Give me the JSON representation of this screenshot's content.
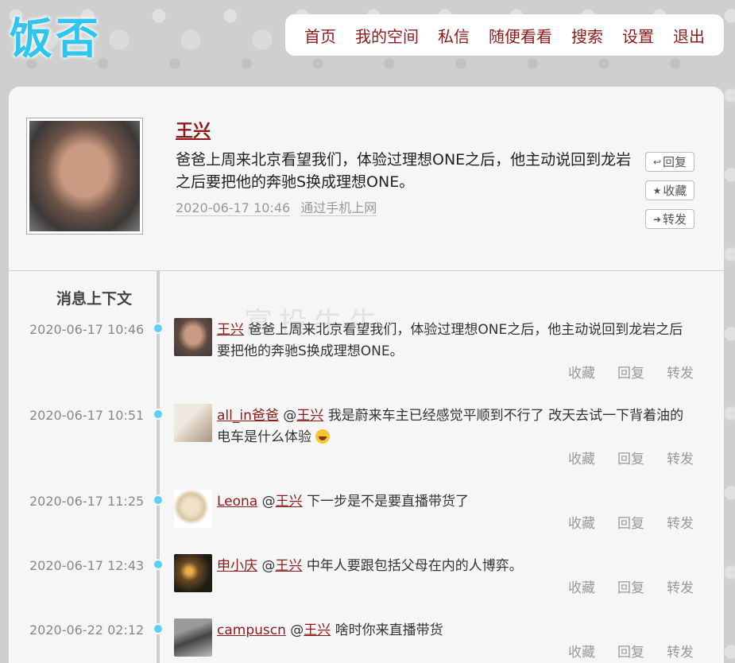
{
  "logo": "饭否",
  "nav": [
    "首页",
    "我的空间",
    "私信",
    "随便看看",
    "搜索",
    "设置",
    "退出"
  ],
  "status": {
    "author": "王兴",
    "text": "爸爸上周来北京看望我们，体验过理想ONE之后，他主动说回到龙岩之后要把他的奔驰S换成理想ONE。",
    "time": "2020-06-17 10:46",
    "source": "通过手机上网",
    "actions": {
      "reply": "回复",
      "fav": "收藏",
      "repost": "转发"
    }
  },
  "context": {
    "title": "消息上下文",
    "watermark": "富投牛牛",
    "ops": {
      "fav": "收藏",
      "reply": "回复",
      "repost": "转发"
    },
    "items": [
      {
        "time": "2020-06-17 10:46",
        "user": "王兴",
        "mention": "",
        "text": "爸爸上周来北京看望我们，体验过理想ONE之后，他主动说回到龙岩之后要把他的奔驰S换成理想ONE。"
      },
      {
        "time": "2020-06-17 10:51",
        "user": "all_in爸爸",
        "mention": "王兴",
        "text": "我是蔚来车主已经感觉平顺到不行了 改天去试一下背着油的电车是什么体验"
      },
      {
        "time": "2020-06-17 11:25",
        "user": "Leona",
        "mention": "王兴",
        "text": "下一步是不是要直播带货了"
      },
      {
        "time": "2020-06-17 12:43",
        "user": "申小庆",
        "mention": "王兴",
        "text": "中年人要跟包括父母在内的人博弈。"
      },
      {
        "time": "2020-06-22 02:12",
        "user": "campuscn",
        "mention": "王兴",
        "text": "啥时你来直播带货"
      }
    ]
  },
  "colors": {
    "accent": "#8b1a1a",
    "logo": "#2ec6f0",
    "dot": "#5dcff2"
  }
}
